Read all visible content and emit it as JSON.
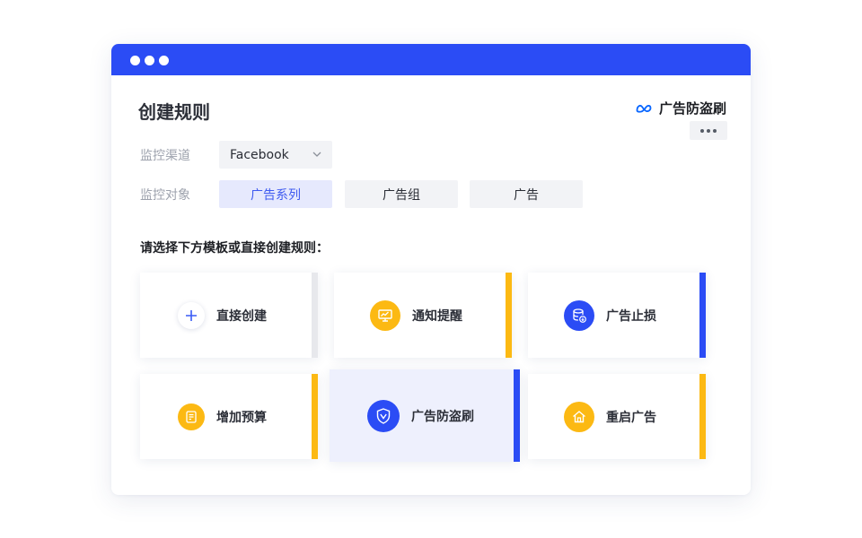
{
  "window": {
    "title": "创建规则"
  },
  "brand": {
    "logo_icon": "meta-logo-icon",
    "text": "广告防盗刷",
    "color": "#0866ff"
  },
  "more_menu": {
    "icon": "more-horizontal-icon"
  },
  "form": {
    "channel_label": "监控渠道",
    "channel_value": "Facebook",
    "target_label": "监控对象",
    "target_options": [
      {
        "label": "广告系列",
        "selected": true
      },
      {
        "label": "广告组",
        "selected": false
      },
      {
        "label": "广告",
        "selected": false
      }
    ]
  },
  "templates": {
    "section_title": "请选择下方模板或直接创建规则：",
    "cards": [
      {
        "label": "直接创建",
        "icon": "plus-icon",
        "accent": "#e7e8ec"
      },
      {
        "label": "通知提醒",
        "icon": "monitor-chart-icon",
        "accent": "#fcb913"
      },
      {
        "label": "广告止损",
        "icon": "database-download-icon",
        "accent": "#2b4cf5"
      },
      {
        "label": "增加预算",
        "icon": "document-edit-icon",
        "accent": "#fcb913"
      },
      {
        "label": "广告防盗刷",
        "icon": "shield-icon",
        "accent": "#2b4cf5",
        "highlighted": true
      },
      {
        "label": "重启广告",
        "icon": "home-icon",
        "accent": "#fcb913"
      }
    ]
  },
  "colors": {
    "primary": "#2b4cf5",
    "warning": "#fcb913",
    "selected_bg": "#e6e9fd"
  }
}
